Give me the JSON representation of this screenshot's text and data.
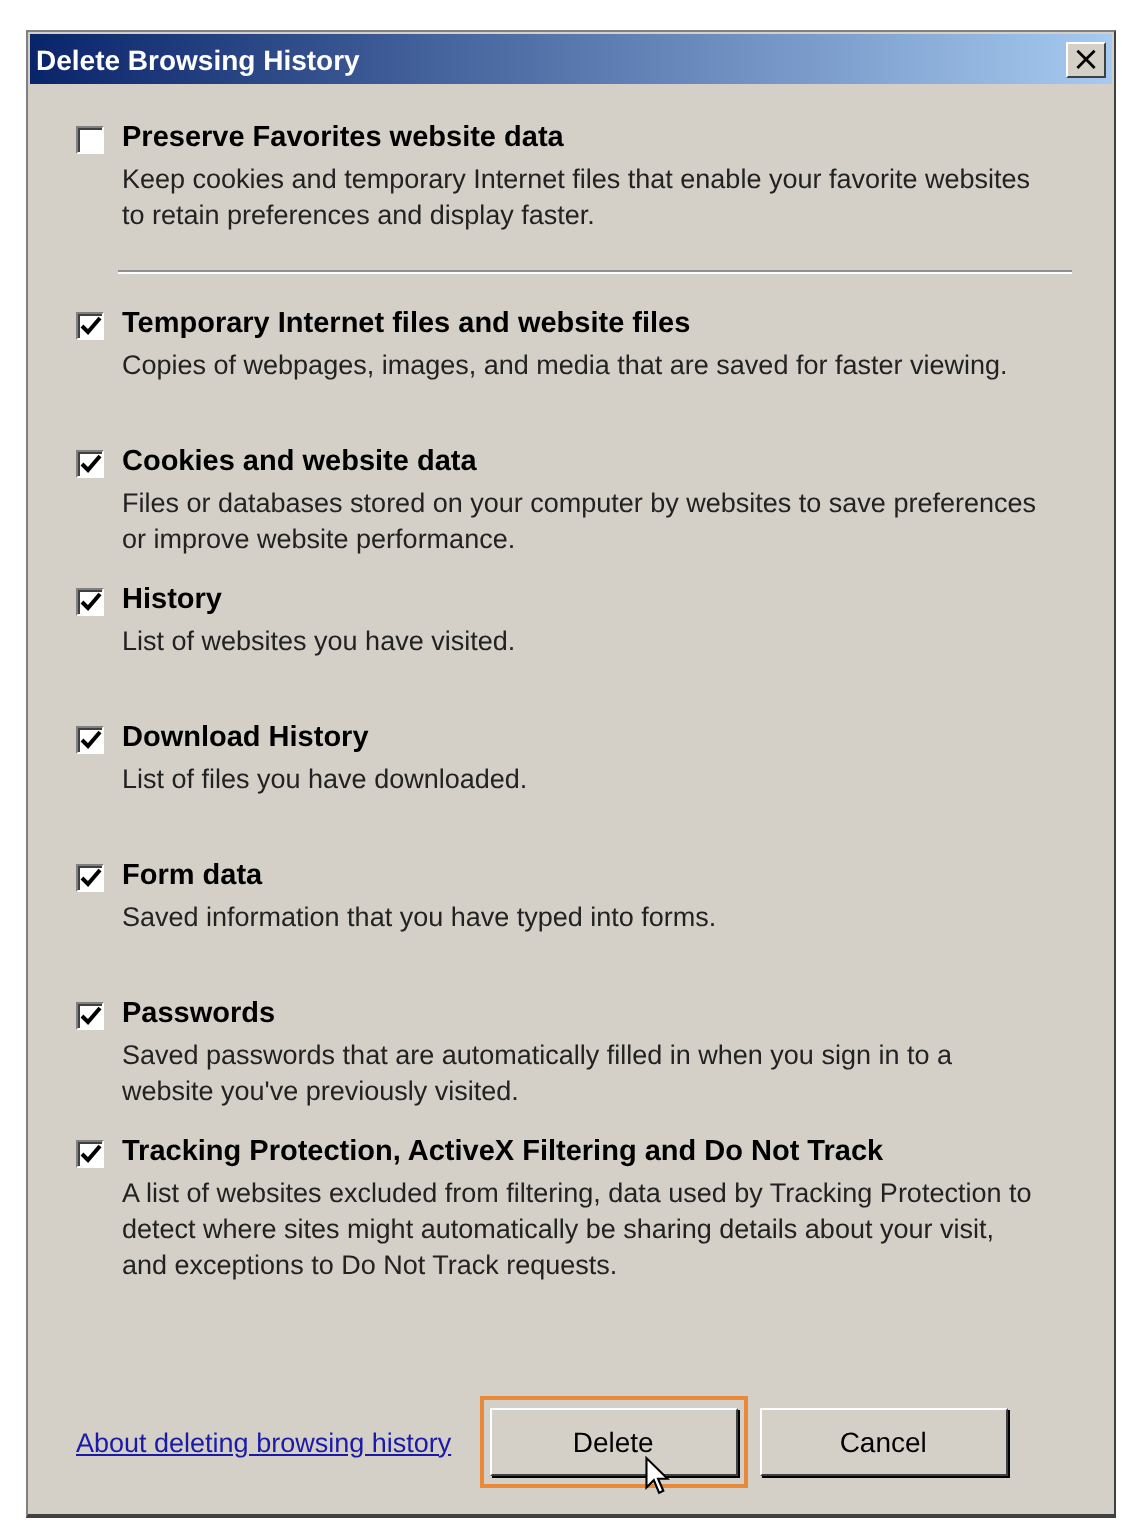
{
  "window": {
    "title": "Delete Browsing History",
    "close": "×"
  },
  "preserve": {
    "label": "Preserve Favorites website data",
    "description": "Keep cookies and temporary Internet files that enable your favorite websites to retain preferences and display faster.",
    "checked": false
  },
  "items": [
    {
      "label": "Temporary Internet files and website files",
      "description": "Copies of webpages, images, and media that are saved for faster viewing.",
      "checked": true
    },
    {
      "label": "Cookies and website data",
      "description": "Files or databases stored on your computer by websites to save preferences or improve website performance.",
      "checked": true
    },
    {
      "label": "History",
      "description": "List of websites you have visited.",
      "checked": true
    },
    {
      "label": "Download History",
      "description": "List of files you have downloaded.",
      "checked": true
    },
    {
      "label": "Form data",
      "description": "Saved information that you have typed into forms.",
      "checked": true
    },
    {
      "label": "Passwords",
      "description": "Saved passwords that are automatically filled in when you sign in to a website you've previously visited.",
      "checked": true
    },
    {
      "label": "Tracking Protection, ActiveX Filtering and Do Not Track",
      "description": "A list of websites excluded from filtering, data used by Tracking Protection to detect where sites might automatically be sharing details about your visit, and exceptions to Do Not Track requests.",
      "checked": true
    }
  ],
  "link": "About deleting browsing history",
  "buttons": [
    {
      "label": "Delete",
      "highlighted": true
    },
    {
      "label": "Cancel",
      "highlighted": false
    }
  ]
}
